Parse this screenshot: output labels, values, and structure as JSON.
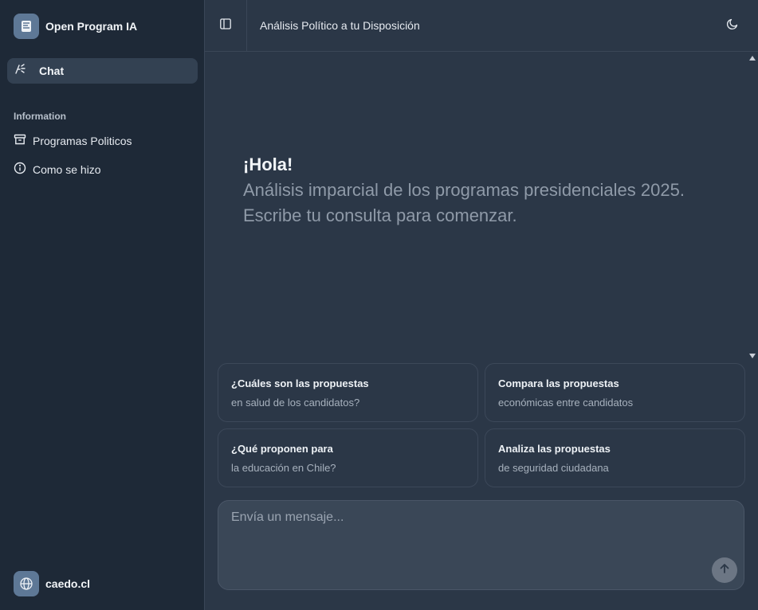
{
  "sidebar": {
    "brand_name": "Open Program IA",
    "chat_label": "Chat",
    "section_title": "Information",
    "items": [
      {
        "label": "Programas Politicos",
        "icon": "archive-icon"
      },
      {
        "label": "Como se hizo",
        "icon": "info-icon"
      }
    ],
    "user_name": "caedo.cl"
  },
  "header": {
    "title": "Análisis Político a tu Disposición"
  },
  "greeting": {
    "title": "¡Hola!",
    "subtitle": "Análisis imparcial de los programas presidenciales 2025. Escribe tu consulta para comenzar."
  },
  "suggestions": [
    {
      "line1": "¿Cuáles son las propuestas",
      "line2": "en salud de los candidatos?"
    },
    {
      "line1": "Compara las propuestas",
      "line2": "económicas entre candidatos"
    },
    {
      "line1": "¿Qué proponen para",
      "line2": "la educación en Chile?"
    },
    {
      "line1": "Analiza las propuestas",
      "line2": "de seguridad ciudadana"
    }
  ],
  "composer": {
    "placeholder": "Envía un mensaje..."
  },
  "colors": {
    "sidebar_bg": "#1e2937",
    "main_bg": "#2b3747",
    "active_item_bg": "#334152",
    "brand_logo_bg": "#5e7896",
    "composer_bg": "#3a4757",
    "send_button_bg": "#6c7684"
  }
}
